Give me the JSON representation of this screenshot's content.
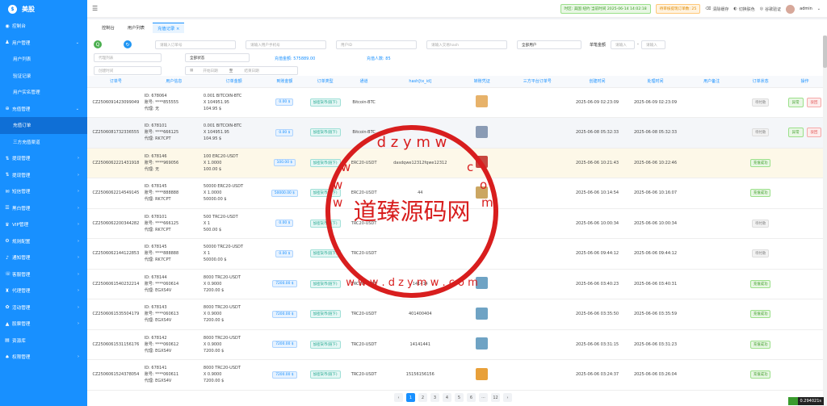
{
  "app": {
    "name": "美股"
  },
  "sidebar": {
    "items": [
      {
        "label": "控制台",
        "icon": "dashboard-icon",
        "type": "top",
        "arrow": ""
      },
      {
        "label": "用户管理",
        "icon": "user-icon",
        "type": "top",
        "arrow": "⌄"
      },
      {
        "label": "用户列表",
        "icon": "",
        "type": "sub",
        "arrow": ""
      },
      {
        "label": "验证记录",
        "icon": "",
        "type": "sub",
        "arrow": ""
      },
      {
        "label": "用户实名管理",
        "icon": "",
        "type": "sub",
        "arrow": ""
      },
      {
        "label": "充值管理",
        "icon": "recharge-icon",
        "type": "top",
        "arrow": "⌄"
      },
      {
        "label": "充值订单",
        "icon": "",
        "type": "sub",
        "arrow": "",
        "active": true
      },
      {
        "label": "三方充值渠道",
        "icon": "",
        "type": "sub",
        "arrow": ""
      },
      {
        "label": "提现管理",
        "icon": "withdraw-icon",
        "type": "top",
        "arrow": "›"
      },
      {
        "label": "提现管理",
        "icon": "withdraw-icon",
        "type": "top",
        "arrow": "›"
      },
      {
        "label": "短信管理",
        "icon": "sms-icon",
        "type": "top",
        "arrow": "›"
      },
      {
        "label": "黑白管理",
        "icon": "list-icon",
        "type": "top",
        "arrow": "›"
      },
      {
        "label": "VIP管理",
        "icon": "vip-icon",
        "type": "top",
        "arrow": "›"
      },
      {
        "label": "规则配置",
        "icon": "rule-icon",
        "type": "top",
        "arrow": "›"
      },
      {
        "label": "通知管理",
        "icon": "bell-icon",
        "type": "top",
        "arrow": "›"
      },
      {
        "label": "客服管理",
        "icon": "service-icon",
        "type": "top",
        "arrow": "›"
      },
      {
        "label": "代理管理",
        "icon": "agent-icon",
        "type": "top",
        "arrow": "›"
      },
      {
        "label": "活动管理",
        "icon": "gift-icon",
        "type": "top",
        "arrow": "›"
      },
      {
        "label": "股票管理",
        "icon": "stock-icon",
        "type": "top",
        "arrow": "›"
      },
      {
        "label": "资源库",
        "icon": "folder-icon",
        "type": "top",
        "arrow": ""
      },
      {
        "label": "权限管理",
        "icon": "lock-icon",
        "type": "top",
        "arrow": "›"
      }
    ]
  },
  "header": {
    "menu_icon": "☰",
    "status_pill": "时区: 美国 纽约 当前时间 2025-06-14 14:02:18",
    "warn_pill": "待审核提现订单数: 25",
    "actions": [
      "清除缓存",
      "切换肤色",
      "谷歌验证"
    ],
    "user": "admin"
  },
  "tabs": [
    {
      "label": "控制台",
      "active": false
    },
    {
      "label": "用户列表",
      "active": false
    },
    {
      "label": "充值记录 ×",
      "active": true
    }
  ],
  "filters": {
    "search_btn": "Q",
    "refresh_btn": "↻",
    "order_no": "请输入订单号",
    "user_account": "请输入用户手机号",
    "user_id": "用户ID",
    "hash": "请输入交易hash",
    "user_type": "全部用户",
    "amount_label": "单笔金额",
    "amount_min": "请输入",
    "amount_sep": "-",
    "amount_max": "请输入",
    "channel": "代理列表",
    "status": "全部状态",
    "create_time": "创建时间",
    "start_date": "开始日期",
    "to": "至",
    "end_date": "结束日期",
    "total_amount": "充值金额: 575889.00",
    "total_users": "充值人数: 85"
  },
  "table": {
    "headers": [
      "订单号",
      "用户信息",
      "订单金额",
      "到账金额",
      "订单类型",
      "通道",
      "hash[tx_id]",
      "转账凭证",
      "三方平台订单号",
      "创建时间",
      "处理时间",
      "用户备注",
      "订单状态",
      "操作"
    ],
    "rows": [
      {
        "order": "CZ2506091423099049",
        "uid": "ID: 678064",
        "acct": "账号: ****855555",
        "agent": "代理: 无",
        "amt1": "0.001 BITCOIN-BTC",
        "amt2": "X 104951.95",
        "amt3": "104.95 $",
        "arrive": "0.00 $",
        "type": "加密货币(链下)",
        "channel": "Bitcoin-BTC",
        "hash": "",
        "thumb": "#e7b26a",
        "created": "2025-06-09 02:23:09",
        "handled": "2025-06-09 02:23:09",
        "status": "待付款",
        "status_type": "grey",
        "ops": true,
        "row": ""
      },
      {
        "order": "CZ2506081732336555",
        "uid": "ID: 678101",
        "acct": "账号: ****666125",
        "agent": "代理: RK7CPT",
        "amt1": "0.001 BITCOIN-BTC",
        "amt2": "X 104951.95",
        "amt3": "104.95 $",
        "arrive": "0.00 $",
        "type": "加密货币(链下)",
        "channel": "Bitcoin-BTC",
        "hash": "",
        "thumb": "#8a9bb4",
        "created": "2025-06-08 05:32:33",
        "handled": "2025-06-08 05:32:33",
        "status": "待付款",
        "status_type": "grey",
        "ops": true,
        "row": "gr"
      },
      {
        "order": "CZ2506062221431918",
        "uid": "ID: 678146",
        "acct": "账号: ****969056",
        "agent": "代理: 无",
        "amt1": "100 ERC20-USDT",
        "amt2": "X 1.0000",
        "amt3": "100.00 $",
        "arrive": "100.00 $",
        "type": "加密货币(链下)",
        "channel": "ERC20-USDT",
        "hash": "dasdqwe12312fqwe12312",
        "thumb": "#c7463e",
        "created": "2025-06-06 10:21:43",
        "handled": "2025-06-06 10:22:46",
        "status": "充值成功",
        "status_type": "green",
        "ops": false,
        "row": "hl"
      },
      {
        "order": "CZ2506062214549145",
        "uid": "ID: 678145",
        "acct": "账号: ****888888",
        "agent": "代理: RK7CPT",
        "amt1": "50000 ERC20-USDT",
        "amt2": "X 1.0000",
        "amt3": "50000.00 $",
        "arrive": "50000.00 $",
        "type": "加密货币(链下)",
        "channel": "ERC20-USDT",
        "hash": "44",
        "thumb": "#c9a25a",
        "created": "2025-06-06 10:14:54",
        "handled": "2025-06-06 10:16:07",
        "status": "充值成功",
        "status_type": "green",
        "ops": false,
        "row": ""
      },
      {
        "order": "CZ2506062200344282",
        "uid": "ID: 678101",
        "acct": "账号: ****666125",
        "agent": "代理: RK7CPT",
        "amt1": "500 TRC20-USDT",
        "amt2": "X 1",
        "amt3": "500.00 $",
        "arrive": "0.00 $",
        "type": "加密货币(链下)",
        "channel": "TRC20-USDT",
        "hash": "",
        "thumb": "",
        "created": "2025-06-06 10:00:34",
        "handled": "2025-06-06 10:00:34",
        "status": "待付款",
        "status_type": "grey",
        "ops": false,
        "row": ""
      },
      {
        "order": "CZ2506062144122853",
        "uid": "ID: 678145",
        "acct": "账号: ****888888",
        "agent": "代理: RK7CPT",
        "amt1": "50000 TRC20-USDT",
        "amt2": "X 1",
        "amt3": "50000.00 $",
        "arrive": "0.00 $",
        "type": "加密货币(链下)",
        "channel": "TRC20-USDT",
        "hash": "",
        "thumb": "",
        "created": "2025-06-06 09:44:12",
        "handled": "2025-06-06 09:44:12",
        "status": "待付款",
        "status_type": "grey",
        "ops": false,
        "row": ""
      },
      {
        "order": "CZ2506061540232214",
        "uid": "ID: 678144",
        "acct": "账号: ****060614",
        "agent": "代理: EGXS4V",
        "amt1": "8000 TRC20-USDT",
        "amt2": "X 0.9000",
        "amt3": "7200.00 $",
        "arrive": "7200.00 $",
        "type": "加密货币(链下)",
        "channel": "TRC20-USDT",
        "hash": "141414",
        "thumb": "#6fa3c4",
        "created": "2025-06-06 03:40:23",
        "handled": "2025-06-06 03:40:31",
        "status": "充值成功",
        "status_type": "green",
        "ops": false,
        "row": ""
      },
      {
        "order": "CZ2506061535504179",
        "uid": "ID: 678143",
        "acct": "账号: ****060613",
        "agent": "代理: EGXS4V",
        "amt1": "8000 TRC20-USDT",
        "amt2": "X 0.9000",
        "amt3": "7200.00 $",
        "arrive": "7200.00 $",
        "type": "加密货币(链下)",
        "channel": "TRC20-USDT",
        "hash": "401400404",
        "thumb": "#6fa3c4",
        "created": "2025-06-06 03:35:50",
        "handled": "2025-06-06 03:35:59",
        "status": "充值成功",
        "status_type": "green",
        "ops": false,
        "row": ""
      },
      {
        "order": "CZ2506061531156176",
        "uid": "ID: 678142",
        "acct": "账号: ****060612",
        "agent": "代理: EGXS4V",
        "amt1": "8000 TRC20-USDT",
        "amt2": "X 0.9000",
        "amt3": "7200.00 $",
        "arrive": "7200.00 $",
        "type": "加密货币(链下)",
        "channel": "TRC20-USDT",
        "hash": "14141441",
        "thumb": "#6fa3c4",
        "created": "2025-06-06 03:31:15",
        "handled": "2025-06-06 03:31:23",
        "status": "充值成功",
        "status_type": "green",
        "ops": false,
        "row": ""
      },
      {
        "order": "CZ2506061524378054",
        "uid": "ID: 678141",
        "acct": "账号: ****060611",
        "agent": "代理: EGXS4V",
        "amt1": "8000 TRC20-USDT",
        "amt2": "X 0.9000",
        "amt3": "7200.00 $",
        "arrive": "7200.00 $",
        "type": "加密货币(链下)",
        "channel": "TRC20-USDT",
        "hash": "15156156156",
        "thumb": "#e8a03a",
        "created": "2025-06-06 03:24:37",
        "handled": "2025-06-06 03:26:04",
        "status": "充值成功",
        "status_type": "green",
        "ops": false,
        "row": ""
      }
    ],
    "op_confirm": "异常",
    "op_reject": "驳回"
  },
  "pager": {
    "prev": "‹",
    "pages": [
      "1",
      "2",
      "3",
      "4",
      "5",
      "6",
      "···",
      "12"
    ],
    "next": "›"
  },
  "watermark": {
    "text": "道臻源码网",
    "url": "www.dzymw.com"
  },
  "corner": {
    "text": "0.294021s"
  }
}
